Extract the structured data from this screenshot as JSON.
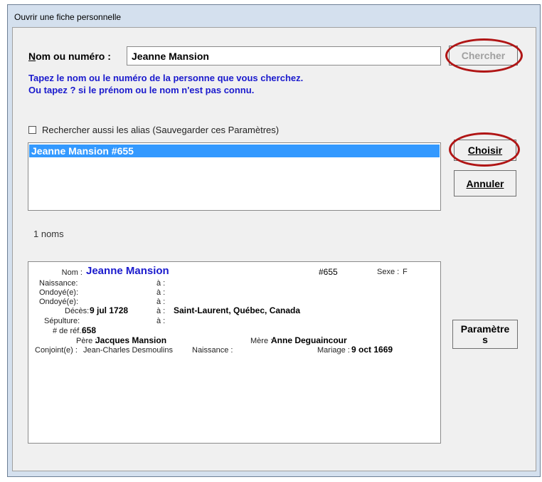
{
  "window": {
    "title": "Ouvrir une fiche personnelle"
  },
  "search": {
    "label_prefix": "N",
    "label_rest": "om ou numéro :",
    "value": "Jeanne Mansion",
    "hint_line1": "Tapez le nom ou le numéro de la personne que vous cherchez.",
    "hint_line2": "Ou tapez  ?  si le prénom ou le nom n'est pas connu."
  },
  "buttons": {
    "search_label": "Chercher",
    "choose_label": "Choisir",
    "cancel_label": "Annuler",
    "params_label_line1": "Paramètre",
    "params_label_line2": "s"
  },
  "options": {
    "alias_checkbox_label": "Rechercher aussi les alias (Sauvegarder ces Paramètres)"
  },
  "results": {
    "items": [
      "Jeanne Mansion  #655"
    ],
    "count_text": "1 noms"
  },
  "details": {
    "name_label": "Nom :",
    "name": "Jeanne Mansion",
    "id": "#655",
    "sex_label": "Sexe :",
    "sex": "F",
    "birth_label": "Naissance:",
    "at": "à :",
    "baptism1_label": "Ondoyé(e):",
    "baptism2_label": "Ondoyé(e):",
    "death_label": "Décès:",
    "death_date": "9 jul 1728",
    "death_place": "Saint-Laurent, Québec, Canada",
    "burial_label": "Sépulture:",
    "ref_label": "# de réf.:",
    "ref": "658",
    "father_label": "Père :",
    "father": "Jacques Mansion",
    "mother_label": "Mère :",
    "mother": "Anne Deguaincour",
    "spouse_label": "Conjoint(e) :",
    "spouse": "Jean-Charles Desmoulins",
    "spouse_birth_label": "Naissance :",
    "marriage_label": "Mariage :",
    "marriage_date": "9 oct 1669"
  },
  "colors": {
    "highlight_circle": "#b01515",
    "hint_text": "#1a1acd",
    "selection": "#3399ff"
  }
}
